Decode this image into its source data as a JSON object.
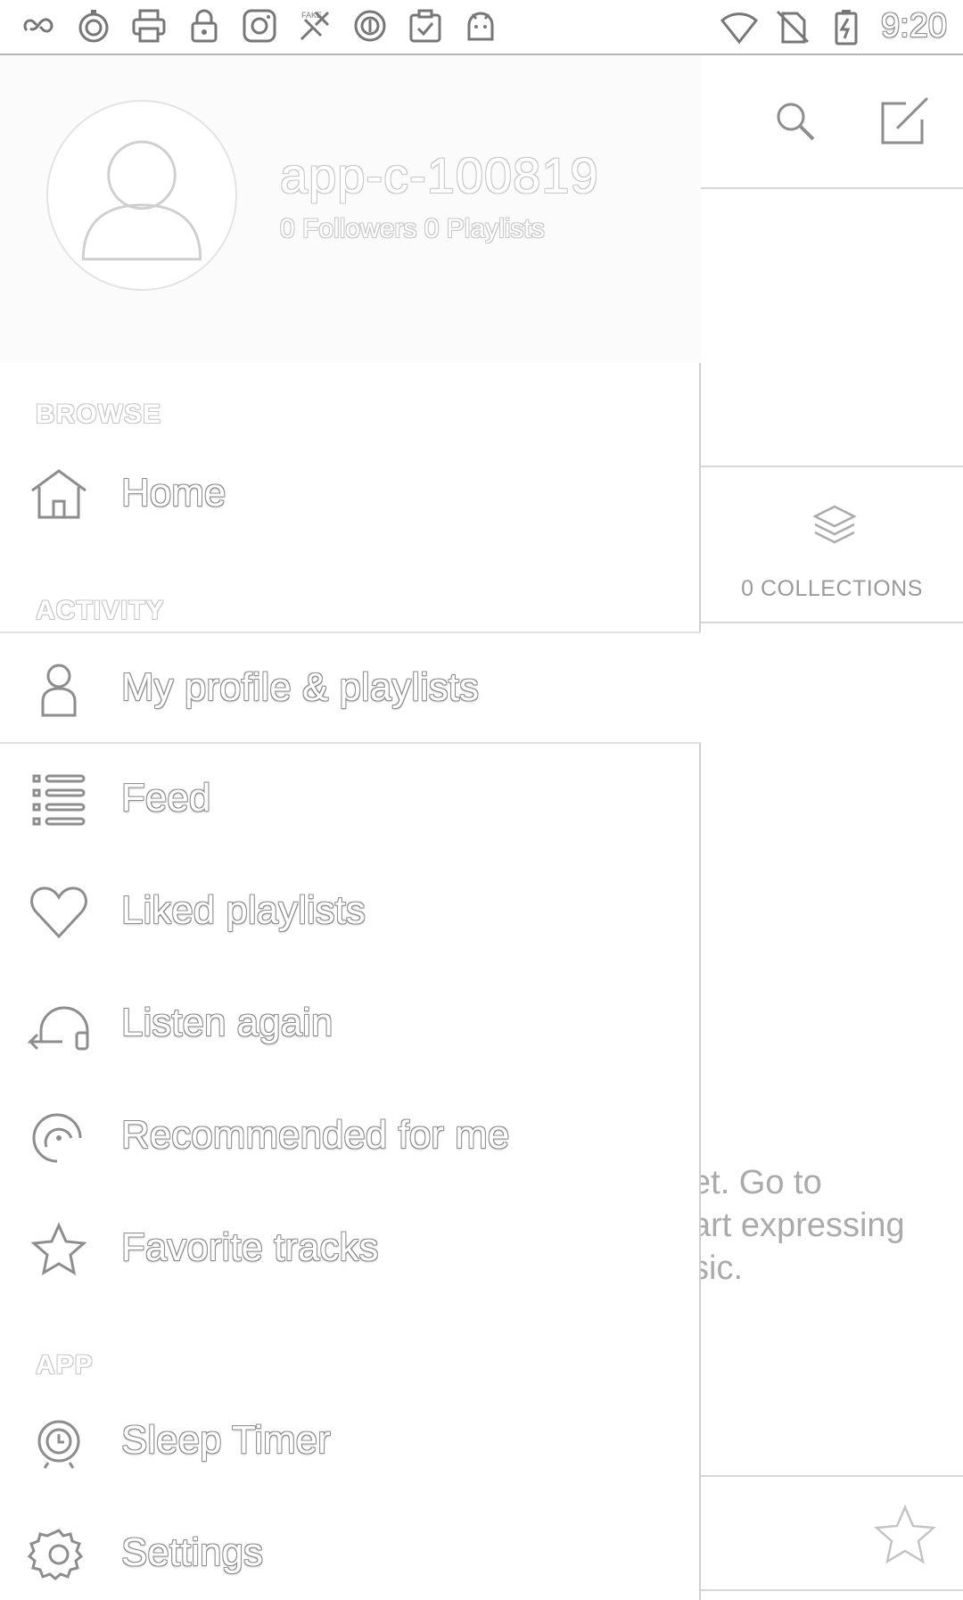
{
  "status_bar": {
    "time": "9:20",
    "left_icons": [
      "link-icon",
      "timer-icon",
      "printer-icon",
      "lock-icon",
      "camera-icon",
      "fake-gps-icon",
      "circle-icon",
      "clipboard-check-icon",
      "android-icon"
    ],
    "right_icons": [
      "wifi-icon",
      "no-sim-icon",
      "battery-charging-icon"
    ]
  },
  "drawer": {
    "profile": {
      "username": "app-c-100819",
      "stats": "0 Followers 0 Playlists"
    },
    "sections": {
      "browse": "BROWSE",
      "activity": "ACTIVITY",
      "app": "APP"
    },
    "items": {
      "home": "Home",
      "my_profile": "My profile & playlists",
      "feed": "Feed",
      "liked_playlists": "Liked playlists",
      "listen_again": "Listen again",
      "recommended": "Recommended for me",
      "favorite_tracks": "Favorite tracks",
      "sleep_timer": "Sleep Timer",
      "settings": "Settings"
    },
    "active_item": "my_profile"
  },
  "background": {
    "collections_label": "0 COLLECTIONS",
    "empty_lines": [
      "et. Go to",
      "art expressing",
      "sic."
    ]
  },
  "colors": {
    "outline": "#8d8d8d",
    "divider": "#d6d6d6",
    "background": "#ffffff"
  }
}
